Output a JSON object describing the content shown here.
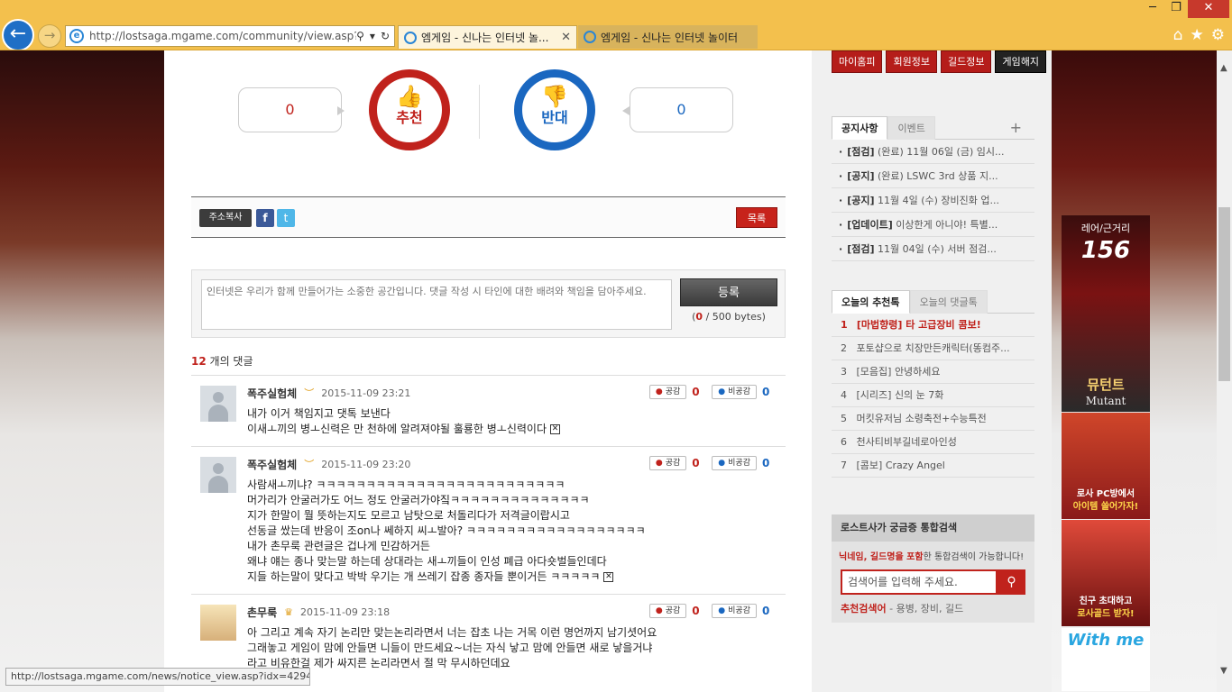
{
  "browser": {
    "url": "http://lostsaga.mgame.com/community/view.asp?gr",
    "tabs": [
      {
        "title": "엠게임 - 신나는 인터넷 놀..."
      },
      {
        "title": "엠게임 - 신나는 인터넷 놀이터"
      }
    ],
    "status_url": "http://lostsaga.mgame.com/news/notice_view.asp?idx=4294"
  },
  "vote": {
    "like_count": "0",
    "like_label": "추천",
    "dislike_label": "반대",
    "dislike_count": "0"
  },
  "share": {
    "copy_label": "주소복사",
    "facebook": "f",
    "twitter": "t",
    "list_label": "목록"
  },
  "comment_form": {
    "placeholder": "인터넷은 우리가 함께 만들어가는 소중한 공간입니다. 댓글 작성 시 타인에 대한 배려와 책임을 담아주세요.",
    "submit_label": "등록",
    "bytes_current": "0",
    "bytes_max": "/ 500 bytes)",
    "bytes_open": "("
  },
  "comments_count": {
    "n": "12",
    "label": "개의 댓글"
  },
  "comments": [
    {
      "nick": "폭주실험체",
      "time": "2015-11-09 23:21",
      "like": "공감",
      "like_n": "0",
      "unlike": "비공감",
      "unlike_n": "0",
      "text": "내가 이거 책임지고 댓톡 보낸다\n이새ㅗ끼의 병ㅗ신력은 만 천하에 알려져야될 훌룡한 병ㅗ신력이다"
    },
    {
      "nick": "폭주실험체",
      "time": "2015-11-09 23:20",
      "like": "공감",
      "like_n": "0",
      "unlike": "비공감",
      "unlike_n": "0",
      "text": "사람새ㅗ끼냐? ㅋㅋㅋㅋㅋㅋㅋㅋㅋㅋㅋㅋㅋㅋㅋㅋㅋㅋㅋㅋㅋㅋㅋㅋㅋ\n머가리가 안굴러가도 어느 정도 안굴러가야짘ㅋㅋㅋㅋㅋㅋㅋㅋㅋㅋㅋㅋㅋㅋ\n지가 한말이 뭘 뜻하는지도 모르고 남탓으로 처돌리다가 저격글이랍시고\n선동글 쌌는데 반응이 조on나 쎄하지 씨ㅗ발아? ㅋㅋㅋㅋㅋㅋㅋㅋㅋㅋㅋㅋㅋㅋㅋㅋㅋㅋ\n내가 촌무룩 관련글은 겁나게 민감하거든\n왜냐 얘는 종나 맞는말 하는데 상대라는 새ㅗ끼들이 인성 폐급 아다숏벌들인데다\n지들 하는말이 맞다고 박박 우기는 개 쓰레기 잡종 종자들 뿐이거든 ㅋㅋㅋㅋㅋ"
    },
    {
      "nick": "촌무룩",
      "time": "2015-11-09 23:18",
      "like": "공감",
      "like_n": "0",
      "unlike": "비공감",
      "unlike_n": "0",
      "text": "아 그리고 계속 자기 논리만 맞는논리라면서 너는 잡초 나는 거목 이런 명언까지 남기셧어요\n그래놓고 게임이 맘에 안들면 니들이 만드세요~너는 자식 낳고 맘에 안들면 새로 낳을거냐\n라고 비유한걸 제가 싸지른 논리라면서 절 막 무시하던데요"
    }
  ],
  "sidebar": {
    "top_buttons": [
      "마이홈피",
      "회원정보",
      "길드정보",
      "게임해지"
    ],
    "notice_tabs": {
      "active": "공지사항",
      "inactive": "이벤트",
      "more": "+"
    },
    "notices": [
      {
        "tag": "[점검]",
        "text": "(완료) 11월 06일 (금) 임시..."
      },
      {
        "tag": "[공지]",
        "text": "(완료) LSWC 3rd 상품 지..."
      },
      {
        "tag": "[공지]",
        "text": "11월 4일 (수) 장비진화 업..."
      },
      {
        "tag": "[업데이트]",
        "text": "이상한게 아니야! 특별..."
      },
      {
        "tag": "[점검]",
        "text": "11월 04일 (수) 서버 점검..."
      }
    ],
    "rec_tabs": {
      "active": "오늘의 추천톡",
      "inactive": "오늘의 댓글톡"
    },
    "recommended": [
      {
        "n": "1",
        "text": "[마법향령] 타 고급장비 콤보!"
      },
      {
        "n": "2",
        "text": "포토샵으로 치장만든캐릭터(똥컴주..."
      },
      {
        "n": "3",
        "text": "[모음집] 안녕하세요"
      },
      {
        "n": "4",
        "text": "[시리즈] 신의 눈 7화"
      },
      {
        "n": "5",
        "text": "머킷유저님 소령축전+수능특전"
      },
      {
        "n": "6",
        "text": "천사티비부길네로아인성"
      },
      {
        "n": "7",
        "text": "[콤보] Crazy Angel"
      }
    ],
    "search": {
      "title": "로스트사가 궁금증 통합검색",
      "desc_highlight": "닉네임, 길드명을 포함",
      "desc_rest": "한 통합검색이 가능합니다!",
      "placeholder": "검색어를 입력해 주세요.",
      "rec_label": "추천검색어",
      "rec_words": " - 용병, 장비, 길드"
    }
  },
  "ads": {
    "a1_top": "레어/근거리",
    "a1_num": "156",
    "a1_name": "뮤턴트",
    "a1_en": "Mutant",
    "a2_line1": "로사 PC방에서",
    "a2_line2": "아이템 쓸어가자!",
    "a3_line1": "친구 초대하고",
    "a3_line2": "로사골드 받자!",
    "a4": "With me"
  }
}
